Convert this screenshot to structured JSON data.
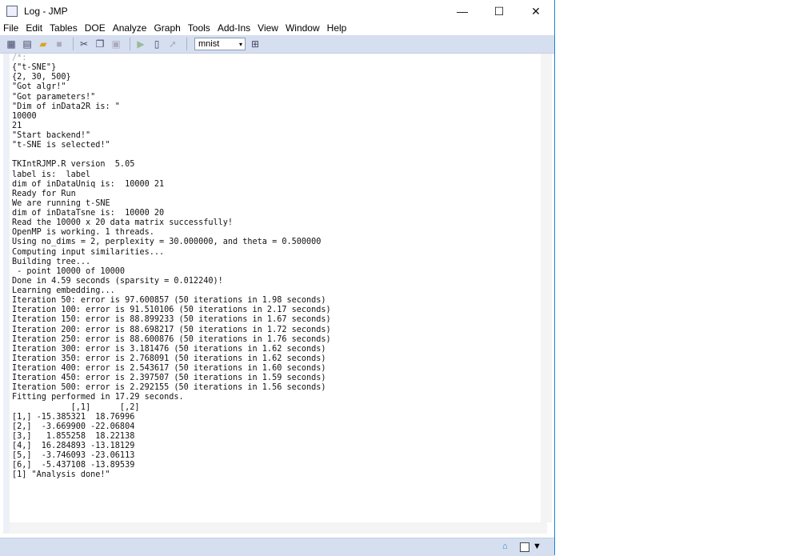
{
  "window": {
    "title": "Log - JMP",
    "minimize": "—",
    "maximize": "☐",
    "close": "✕"
  },
  "menu": [
    "File",
    "Edit",
    "Tables",
    "DOE",
    "Analyze",
    "Graph",
    "Tools",
    "Add-Ins",
    "View",
    "Window",
    "Help"
  ],
  "toolbar": {
    "table_select": "mnist"
  },
  "log_lines": [
    "/*:",
    "{\"t-SNE\"}",
    "{2, 30, 500}",
    "\"Got algr!\"",
    "\"Got parameters!\"",
    "\"Dim of inData2R is: \"",
    "10000",
    "21",
    "\"Start backend!\"",
    "\"t-SNE is selected!\"",
    "",
    "TKIntRJMP.R version  5.05",
    "label is:  label",
    "dim of inDataUniq is:  10000 21",
    "Ready for Run",
    "We are running t-SNE",
    "dim of inDataTsne is:  10000 20",
    "Read the 10000 x 20 data matrix successfully!",
    "OpenMP is working. 1 threads.",
    "Using no_dims = 2, perplexity = 30.000000, and theta = 0.500000",
    "Computing input similarities...",
    "Building tree...",
    " - point 10000 of 10000",
    "Done in 4.59 seconds (sparsity = 0.012240)!",
    "Learning embedding...",
    "Iteration 50: error is 97.600857 (50 iterations in 1.98 seconds)",
    "Iteration 100: error is 91.510106 (50 iterations in 2.17 seconds)",
    "Iteration 150: error is 88.899233 (50 iterations in 1.67 seconds)",
    "Iteration 200: error is 88.698217 (50 iterations in 1.72 seconds)",
    "Iteration 250: error is 88.600876 (50 iterations in 1.76 seconds)",
    "Iteration 300: error is 3.181476 (50 iterations in 1.62 seconds)",
    "Iteration 350: error is 2.768091 (50 iterations in 1.62 seconds)",
    "Iteration 400: error is 2.543617 (50 iterations in 1.60 seconds)",
    "Iteration 450: error is 2.397507 (50 iterations in 1.59 seconds)",
    "Iteration 500: error is 2.292155 (50 iterations in 1.56 seconds)",
    "Fitting performed in 17.29 seconds.",
    "            [,1]      [,2]",
    "[1,] -15.385321  18.76996",
    "[2,]  -3.669900 -22.06804",
    "[3,]   1.855258  18.22138",
    "[4,]  16.284893 -13.18129",
    "[5,]  -3.746093 -23.06113",
    "[6,]  -5.437108 -13.89539",
    "[1] \"Analysis done!\""
  ]
}
